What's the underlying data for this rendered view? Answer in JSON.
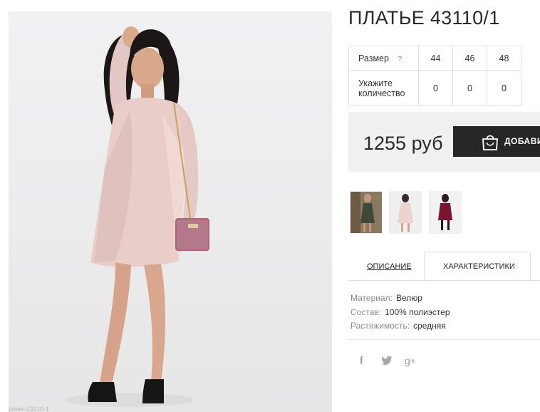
{
  "product": {
    "title": "ПЛАТЬЕ 43110/1",
    "photo_caption": "platie-43110-1"
  },
  "sizes": {
    "size_label": "Размер",
    "help_glyph": "?",
    "quantity_label": "Укажите количество",
    "columns": [
      "44",
      "46",
      "48"
    ],
    "quantities": [
      "0",
      "0",
      "0"
    ]
  },
  "purchase": {
    "price": "1255 руб",
    "add_label": "ДОБАВИТЬ"
  },
  "thumbnails": [
    {
      "color": "green"
    },
    {
      "color": "pink"
    },
    {
      "color": "burgundy"
    }
  ],
  "tabs": {
    "description": "ОПИСАНИЕ",
    "characteristics": "ХАРАКТЕРИСТИКИ"
  },
  "characteristics": [
    {
      "key": "Материал:",
      "value": "Велюр"
    },
    {
      "key": "Состав:",
      "value": "100% полиэстер"
    },
    {
      "key": "Растяжимость:",
      "value": "средняя"
    }
  ],
  "social": {
    "facebook": "f",
    "twitter": "🐦",
    "googleplus": "g+"
  },
  "colors": {
    "button_bg": "#262626",
    "price_bar_bg": "#f0f0f0",
    "dress_pink": "#e9d1cc"
  }
}
